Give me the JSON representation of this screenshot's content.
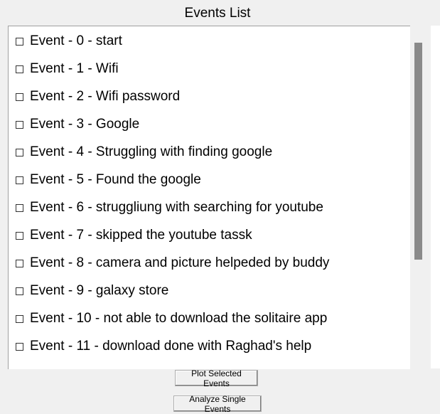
{
  "window": {
    "title": "Events List"
  },
  "events": [
    {
      "label": "Event - 0 - start",
      "checked": false
    },
    {
      "label": "Event - 1 - Wifi",
      "checked": false
    },
    {
      "label": "Event - 2 - Wifi password",
      "checked": false
    },
    {
      "label": "Event - 3 - Google",
      "checked": false
    },
    {
      "label": "Event - 4 - Struggling with finding google",
      "checked": false
    },
    {
      "label": "Event - 5 - Found the google",
      "checked": false
    },
    {
      "label": "Event - 6 - struggliung with searching for youtube",
      "checked": false
    },
    {
      "label": "Event - 7 - skipped the youtube tassk",
      "checked": false
    },
    {
      "label": "Event - 8 - camera and picture helpeded by buddy",
      "checked": false
    },
    {
      "label": "Event - 9 - galaxy store",
      "checked": false
    },
    {
      "label": "Event - 10 - not able to download the solitaire app",
      "checked": false
    },
    {
      "label": "Event - 11 - download done with Raghad's help",
      "checked": false
    }
  ],
  "buttons": {
    "plot_label": "Plot Selected Events",
    "analyze_label": "Analyze Single Events"
  }
}
